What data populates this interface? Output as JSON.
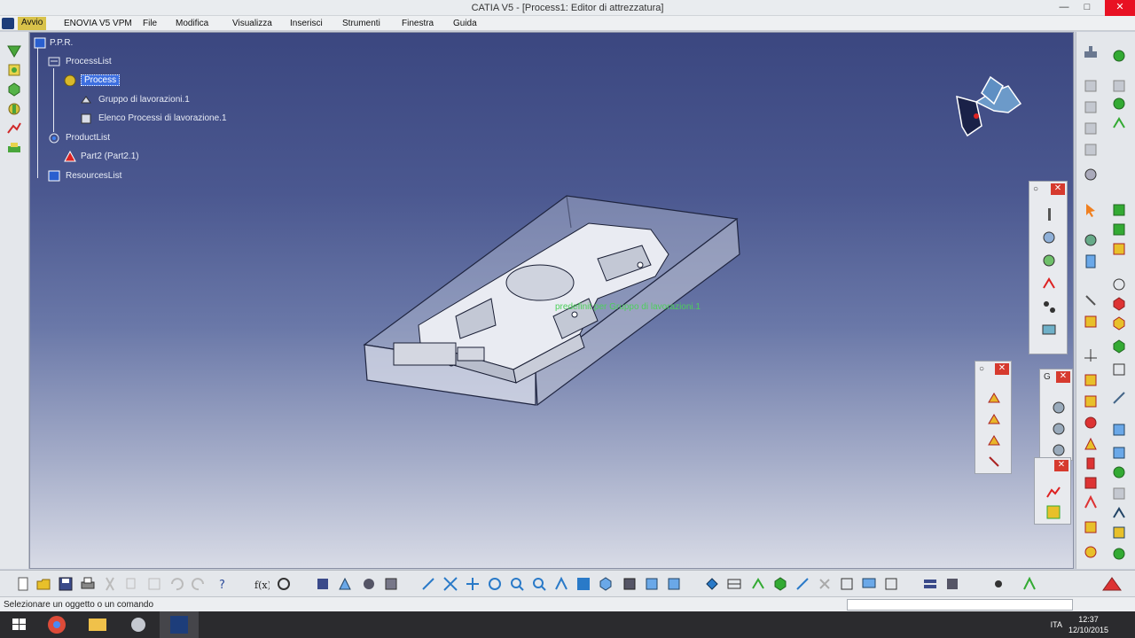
{
  "window": {
    "title": "CATIA V5 - [Process1: Editor di attrezzatura]",
    "controls": [
      "—",
      "□",
      "✕"
    ]
  },
  "menubar": {
    "items": [
      "Avvio",
      "ENOVIA V5 VPM",
      "File",
      "Modifica",
      "Visualizza",
      "Inserisci",
      "Strumenti",
      "Finestra",
      "Guida"
    ]
  },
  "tree": {
    "root": "P.P.R.",
    "process_list": "ProcessList",
    "process": "Process",
    "group": "Gruppo di lavorazioni.1",
    "process_elements": "Elenco Processi di lavorazione.1",
    "product_list": "ProductList",
    "part": "Part2 (Part2.1)",
    "resources_list": "ResourcesList"
  },
  "viewport": {
    "annotation": "predefinit per Gruppo di lavorazioni.1"
  },
  "floating_toolbars": {
    "g_label": "G"
  },
  "status": {
    "message": "Selezionare un oggetto o un comando"
  },
  "taskbar": {
    "language": "ITA",
    "time": "12:37",
    "date": "12/10/2015"
  },
  "colors": {
    "accent_menu": "#d8c24a",
    "viewport_top": "#3b4780",
    "viewport_bottom": "#d8dbe6",
    "selection": "#3d6fe0",
    "annotation": "#4cd05a"
  }
}
